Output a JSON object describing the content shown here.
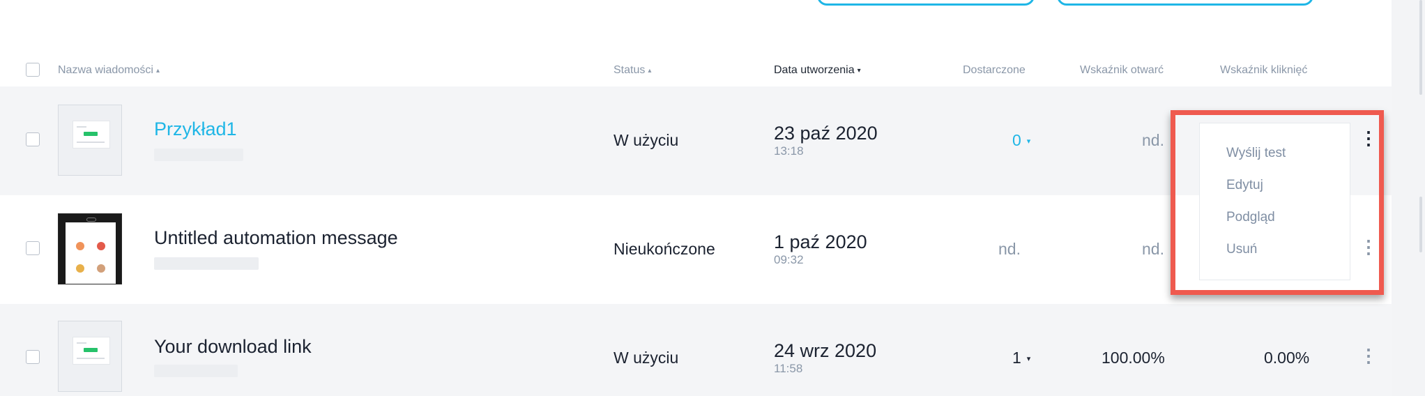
{
  "table": {
    "columns": {
      "name": "Nazwa wiadomości",
      "status": "Status",
      "created": "Data utworzenia",
      "delivered": "Dostarczone",
      "open_rate": "Wskaźnik otwarć",
      "click_rate": "Wskaźnik kliknięć"
    },
    "sort_asc_glyph": "▴",
    "sort_desc_glyph": "▾",
    "rows": [
      {
        "name": "Przykład1",
        "status": "W użyciu",
        "date": "23 paź 2020",
        "time": "13:18",
        "delivered": "0",
        "open_rate": "nd.",
        "click_rate": ""
      },
      {
        "name": "Untitled automation message",
        "status": "Nieukończone",
        "date": "1 paź 2020",
        "time": "09:32",
        "delivered": "nd.",
        "open_rate": "nd.",
        "click_rate": ""
      },
      {
        "name": "Your download link",
        "status": "W użyciu",
        "date": "24 wrz 2020",
        "time": "11:58",
        "delivered": "1",
        "open_rate": "100.00%",
        "click_rate": "0.00%"
      }
    ]
  },
  "context_menu": {
    "items": [
      "Wyślij test",
      "Edytuj",
      "Podgląd",
      "Usuń"
    ]
  },
  "icons": {
    "kebab": "⋮",
    "dropdown_caret": "▾"
  },
  "colors": {
    "accent": "#1fb6e6",
    "highlight": "#ef5a4f",
    "row_alt": "#f4f5f7",
    "muted_text": "#8a97a8"
  }
}
